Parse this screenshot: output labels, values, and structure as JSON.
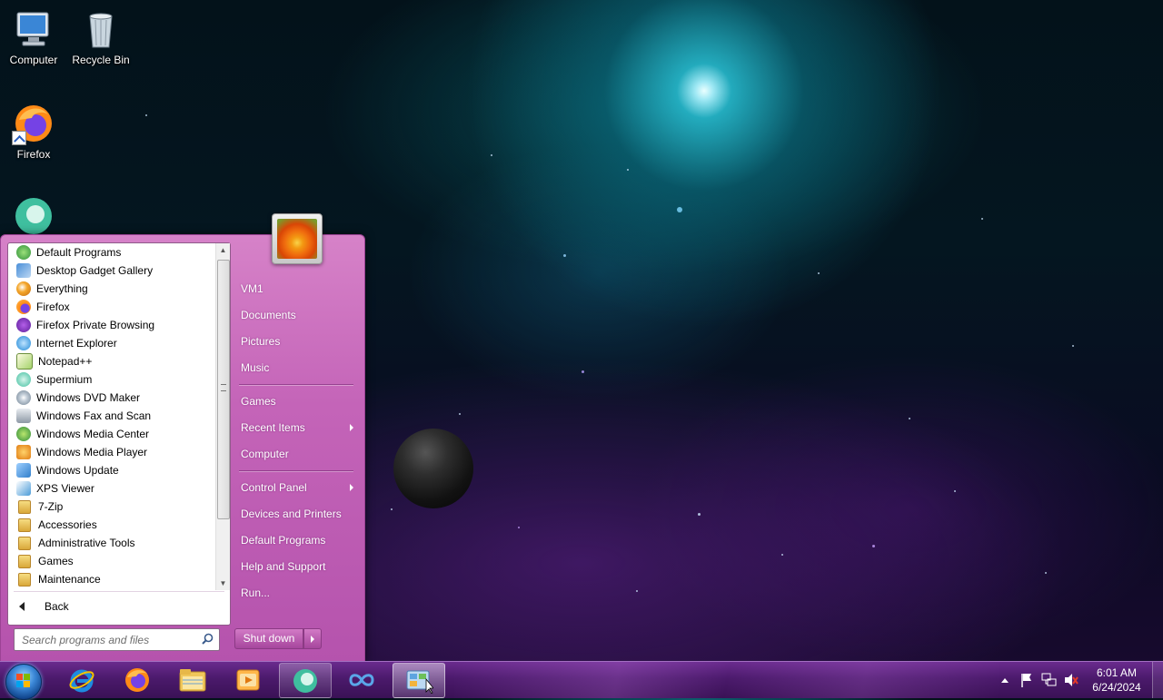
{
  "desktop": {
    "icons": [
      {
        "label": "Computer",
        "icon": "computer-icon"
      },
      {
        "label": "Recycle Bin",
        "icon": "recycle-bin-icon"
      },
      {
        "label": "Firefox",
        "icon": "firefox-icon"
      },
      {
        "label": "",
        "icon": "supermium-icon"
      }
    ]
  },
  "start_menu": {
    "programs": [
      {
        "label": "Default Programs",
        "icon": "default-programs-icon"
      },
      {
        "label": "Desktop Gadget Gallery",
        "icon": "gadget-gallery-icon"
      },
      {
        "label": "Everything",
        "icon": "everything-search-icon"
      },
      {
        "label": "Firefox",
        "icon": "firefox-icon"
      },
      {
        "label": "Firefox Private Browsing",
        "icon": "firefox-private-icon"
      },
      {
        "label": "Internet Explorer",
        "icon": "internet-explorer-icon"
      },
      {
        "label": "Notepad++",
        "icon": "notepad-plus-icon"
      },
      {
        "label": "Supermium",
        "icon": "supermium-icon"
      },
      {
        "label": "Windows DVD Maker",
        "icon": "dvd-maker-icon"
      },
      {
        "label": "Windows Fax and Scan",
        "icon": "fax-scan-icon"
      },
      {
        "label": "Windows Media Center",
        "icon": "media-center-icon"
      },
      {
        "label": "Windows Media Player",
        "icon": "media-player-icon"
      },
      {
        "label": "Windows Update",
        "icon": "windows-update-icon"
      },
      {
        "label": "XPS Viewer",
        "icon": "xps-viewer-icon"
      },
      {
        "label": "7-Zip",
        "icon": "folder-icon"
      },
      {
        "label": "Accessories",
        "icon": "folder-icon"
      },
      {
        "label": "Administrative Tools",
        "icon": "folder-icon"
      },
      {
        "label": "Games",
        "icon": "folder-icon"
      },
      {
        "label": "Maintenance",
        "icon": "folder-icon"
      }
    ],
    "back_label": "Back",
    "search_placeholder": "Search programs and files",
    "right_pane": {
      "user": "VM1",
      "documents": "Documents",
      "pictures": "Pictures",
      "music": "Music",
      "games": "Games",
      "recent_items": "Recent Items",
      "computer": "Computer",
      "control_panel": "Control Panel",
      "devices_printers": "Devices and Printers",
      "default_programs": "Default Programs",
      "help_support": "Help and Support",
      "run": "Run..."
    },
    "shutdown_label": "Shut down"
  },
  "taskbar": {
    "pinned": [
      {
        "icon": "internet-explorer-icon"
      },
      {
        "icon": "firefox-icon"
      },
      {
        "icon": "file-explorer-icon"
      },
      {
        "icon": "media-player-icon"
      },
      {
        "icon": "supermium-icon"
      },
      {
        "icon": "infinity-icon"
      },
      {
        "icon": "control-panel-icon"
      }
    ],
    "clock": {
      "time": "6:01 AM",
      "date": "6/24/2024"
    }
  }
}
